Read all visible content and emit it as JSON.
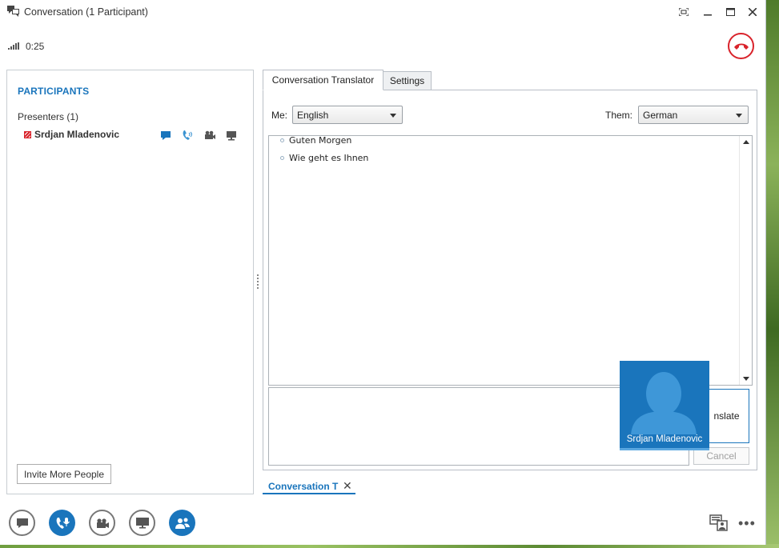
{
  "window": {
    "title": "Conversation (1 Participant)"
  },
  "status": {
    "call_timer": "0:25"
  },
  "participants": {
    "heading": "PARTICIPANTS",
    "group_label": "Presenters (1)",
    "people": [
      {
        "name": "Srdjan Mladenovic"
      }
    ],
    "invite_label": "Invite More People"
  },
  "translator": {
    "tabs": [
      {
        "label": "Conversation Translator"
      },
      {
        "label": "Settings"
      }
    ],
    "me_label": "Me:",
    "me_language": "English",
    "them_label": "Them:",
    "them_language": "German",
    "messages": [
      "Guten Morgen",
      "Wie geht es Ihnen"
    ],
    "translate_label": "nslate",
    "cancel_label": "Cancel"
  },
  "video_tile": {
    "name": "Srdjan Mladenovic"
  },
  "conversation_tab": {
    "label": "Conversation T",
    "close_glyph": "✕"
  },
  "toolbar": {
    "more_glyph": "•••"
  },
  "colors": {
    "accent": "#1a75bc",
    "hangup": "#d9232b"
  }
}
